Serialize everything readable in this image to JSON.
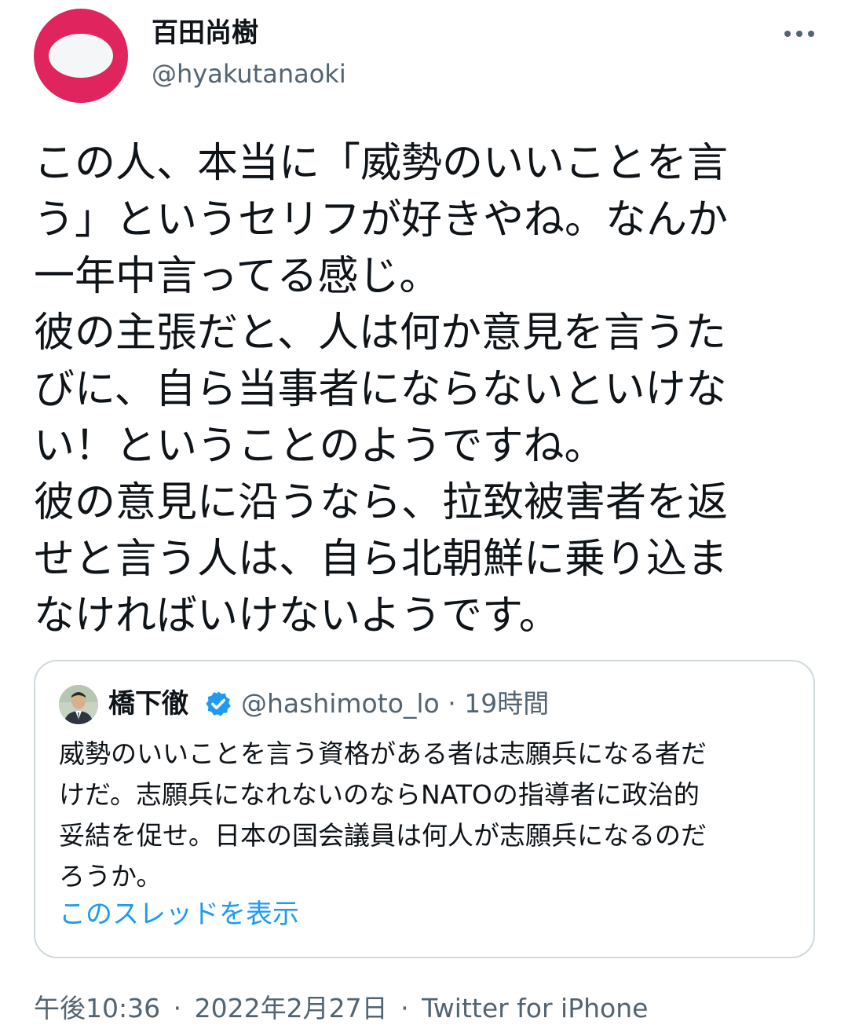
{
  "author": {
    "display_name": "百田尚樹",
    "handle": "@hyakutanaoki",
    "avatar_icon": "avatar-icon",
    "more_icon": "more-icon"
  },
  "tweet": {
    "lines": [
      "この人、本当に「威勢のいいことを言",
      "う」というセリフが好きやね。なんか",
      "一年中言ってる感じ。",
      "彼の主張だと、人は何か意見を言うた",
      "びに、自ら当事者にならないといけな",
      "い！ということのようですね。",
      "彼の意見に沿うなら、拉致被害者を返",
      "せと言う人は、自ら北朝鮮に乗り込ま",
      "なければいけないようです。"
    ]
  },
  "quoted_tweet": {
    "display_name": "橋下徹",
    "verified_icon": "verified-badge-icon",
    "meta": "@hashimoto_lo · 19時間",
    "lines": [
      "威勢のいいことを言う資格がある者は志願兵になる者だ",
      "けだ。志願兵になれないのならNATOの指導者に政治的",
      "妥結を促せ。日本の国会議員は何人が志願兵になるのだ",
      "ろうか。"
    ],
    "show_thread_label": "このスレッドを表示"
  },
  "footer": {
    "time": "午後10:36",
    "separator": "·",
    "date": "2022年2月27日",
    "source": "Twitter for iPhone"
  },
  "colors": {
    "avatar_bg": "#e0245e",
    "link": "#1d9bf0",
    "secondary_text": "#536471",
    "border": "#cfd9de",
    "verified": "#1d9bf0"
  }
}
